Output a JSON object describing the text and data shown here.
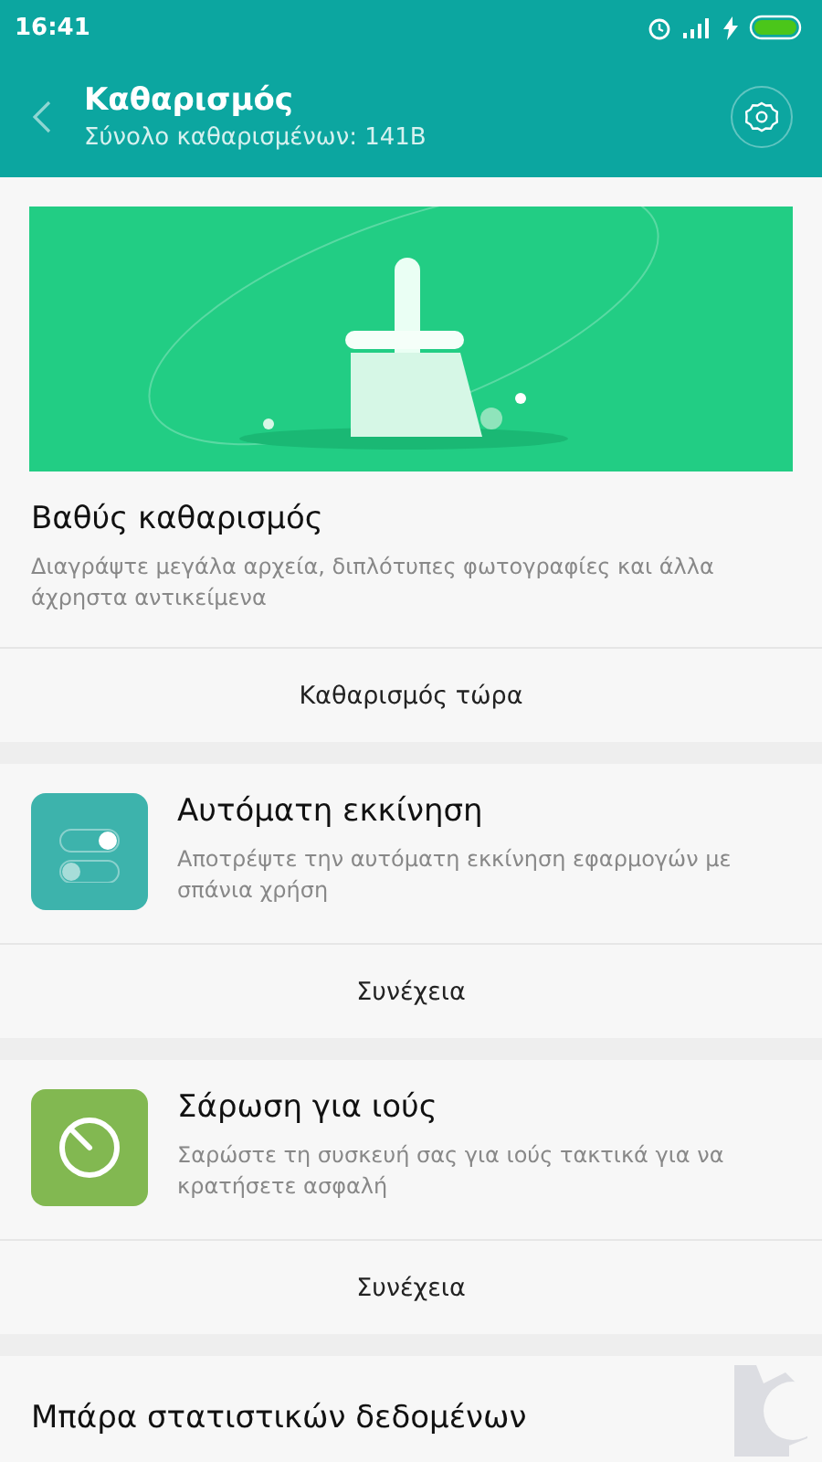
{
  "status_bar": {
    "time": "16:41"
  },
  "header": {
    "title": "Καθαρισμός",
    "subtitle": "Σύνολο καθαρισμένων: 141B"
  },
  "cards": [
    {
      "kind": "banner",
      "title": "Βαθύς καθαρισμός",
      "description": "Διαγράψτε μεγάλα αρχεία, διπλότυπες φωτογραφίες και άλλα άχρηστα αντικείμενα",
      "action": "Καθαρισμός τώρα"
    },
    {
      "kind": "feature",
      "color": "#3db3ac",
      "title": "Αυτόματη εκκίνηση",
      "description": "Αποτρέψτε την αυτόματη εκκίνηση εφαρμογών με σπάνια χρήση",
      "action": "Συνέχεια"
    },
    {
      "kind": "feature",
      "color": "#82b851",
      "title": "Σάρωση για ιούς",
      "description": "Σαρώστε τη συσκευή σας για ιούς τακτικά για να κρατήσετε ασφαλή",
      "action": "Συνέχεια"
    },
    {
      "kind": "plain",
      "title": "Μπάρα στατιστικών δεδομένων"
    }
  ]
}
